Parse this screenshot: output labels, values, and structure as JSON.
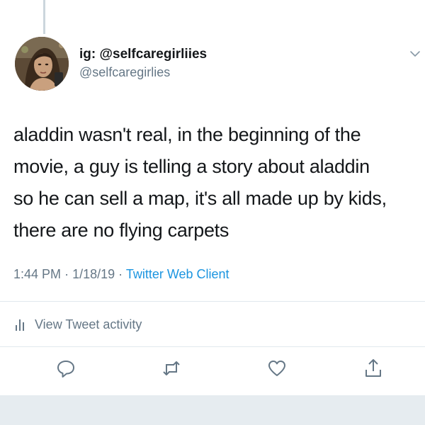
{
  "user": {
    "display_name": "ig: @selfcaregirliies",
    "handle": "@selfcaregirlies"
  },
  "tweet": {
    "lines": [
      "aladdin wasn't real, in the beginning of the",
      "movie, a guy is telling a story about aladdin",
      "so he can sell a map, it's all made up by kids,",
      "there are no flying carpets"
    ],
    "time": "1:44 PM",
    "date": "1/18/19",
    "separator": "·",
    "client": "Twitter Web Client"
  },
  "activity": {
    "label": "View Tweet activity"
  },
  "actions": [
    "reply-icon",
    "retweet-icon",
    "like-icon",
    "share-icon"
  ],
  "colors": {
    "text": "#14171a",
    "secondary": "#657786",
    "link": "#1b95e0",
    "divider": "#e1e8ed",
    "band": "#e6ecf0"
  }
}
